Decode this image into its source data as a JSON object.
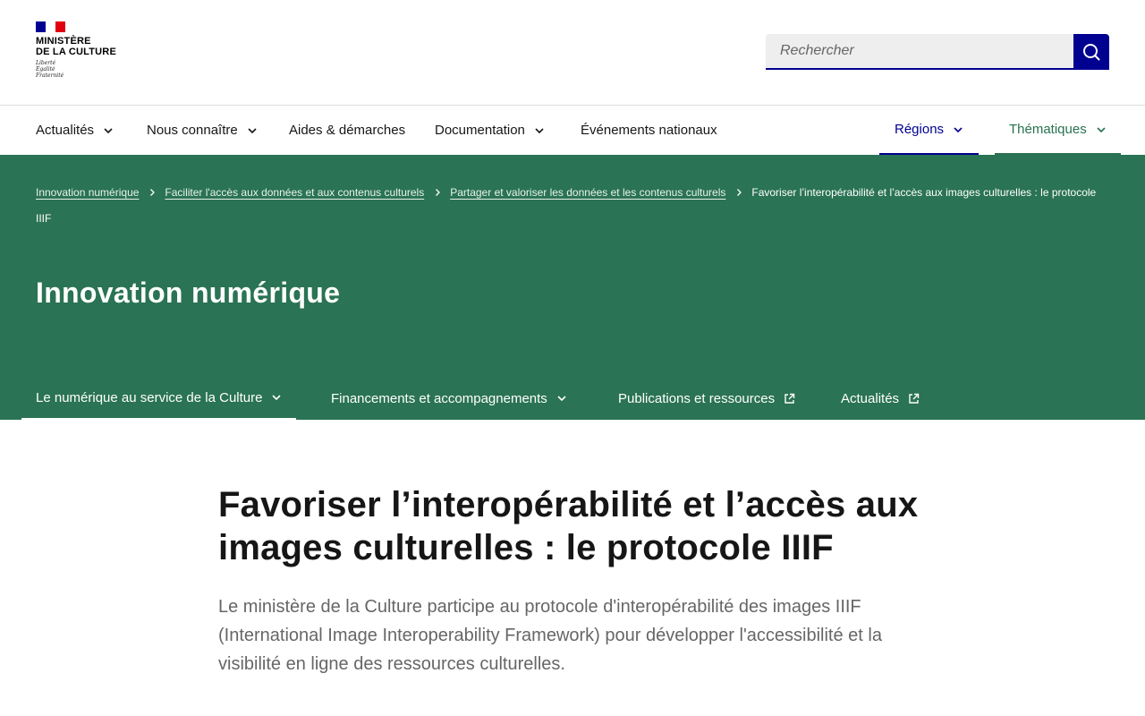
{
  "header": {
    "logo": {
      "title_line1": "Ministère",
      "title_line2": "de la Culture",
      "motto_line1": "Liberté",
      "motto_line2": "Égalité",
      "motto_line3": "Fraternité"
    },
    "search": {
      "placeholder": "Rechercher",
      "value": ""
    }
  },
  "nav": {
    "items": [
      {
        "label": "Actualités",
        "has_dropdown": true
      },
      {
        "label": "Nous connaître",
        "has_dropdown": true
      },
      {
        "label": "Aides & démarches",
        "has_dropdown": false
      },
      {
        "label": "Documentation",
        "has_dropdown": true
      },
      {
        "label": "Événements nationaux",
        "has_dropdown": false
      }
    ],
    "regions": {
      "label": "Régions"
    },
    "themes": {
      "label": "Thématiques"
    }
  },
  "breadcrumb": {
    "items": [
      "Innovation numérique",
      "Faciliter l'accès aux données et aux contenus culturels",
      "Partager et valoriser les données et les contenus culturels"
    ],
    "current": "Favoriser l’interopérabilité et l’accès aux images culturelles : le protocole IIIF"
  },
  "section": {
    "title": "Innovation numérique",
    "subnav": [
      {
        "label": "Le numérique au service de la Culture",
        "icon": "chevron-down-icon",
        "active": true
      },
      {
        "label": "Financements et accompagnements",
        "icon": "chevron-down-icon",
        "active": false
      },
      {
        "label": "Publications et ressources",
        "icon": "external-link-icon",
        "active": false
      },
      {
        "label": "Actualités",
        "icon": "external-link-icon",
        "active": false
      }
    ]
  },
  "article": {
    "title": "Favoriser l’interopérabilité et l’accès aux images culturelles : le protocole IIIF",
    "lead": "Le ministère de la Culture participe au protocole d'interopérabilité des images IIIF (International Image Interoperability Framework) pour développer l'accessibilité et la visibilité en ligne des ressources culturelles."
  },
  "colors": {
    "brand_blue": "#000091",
    "brand_red": "#e1000f",
    "band_green": "#2a7354",
    "themes_green": "#27714f"
  }
}
